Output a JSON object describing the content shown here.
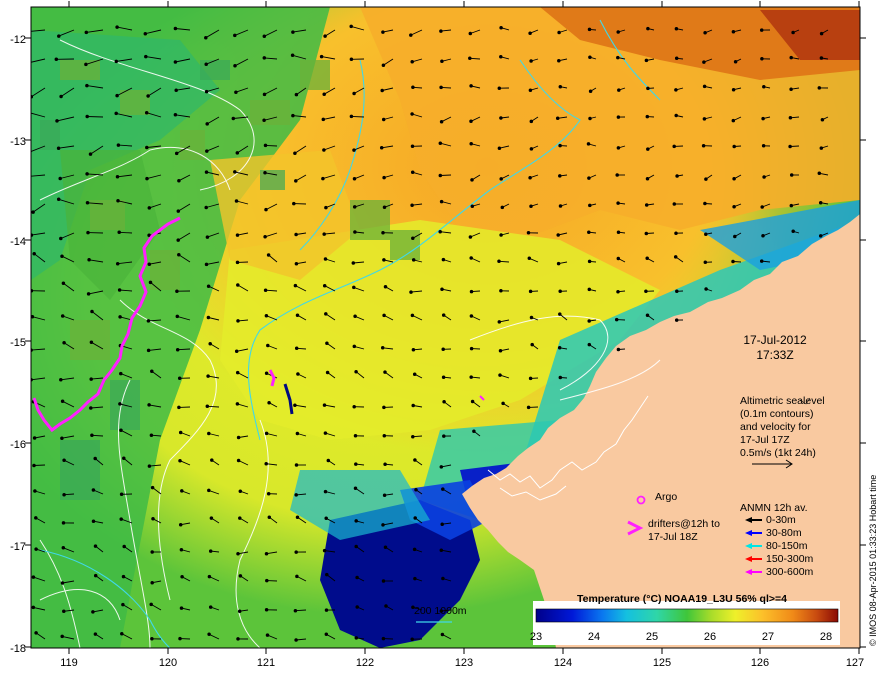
{
  "map": {
    "lon_ticks": [
      "119",
      "120",
      "121",
      "122",
      "123",
      "124",
      "125",
      "126",
      "127"
    ],
    "lat_ticks": [
      "-12",
      "-13",
      "-14",
      "-15",
      "-16",
      "-17",
      "-18"
    ],
    "land_color": "#f9c9a0",
    "contour_color": "#ffffff",
    "isobath_color": "#40d8e8"
  },
  "annotation": {
    "date": "17-Jul-2012",
    "time": "17:33Z",
    "altimetry_lines": [
      "Altimetric sealevel",
      "(0.1m contours)",
      "and velocity for",
      "17-Jul 17Z",
      "0.5m/s (1kt 24h)"
    ]
  },
  "legend": {
    "argo_label": "Argo",
    "drifters_lines": [
      "drifters@12h to",
      "17-Jul 18Z"
    ],
    "anmn_title": "ANMN 12h av.",
    "anmn_items": [
      {
        "label": "0-30m",
        "color": "#000000"
      },
      {
        "label": "30-80m",
        "color": "#0000ff"
      },
      {
        "label": "80-150m",
        "color": "#00e5e5"
      },
      {
        "label": "150-300m",
        "color": "#ff0000"
      },
      {
        "label": "300-600m",
        "color": "#ff00ff"
      }
    ],
    "isobath_label": "200  1000m"
  },
  "colorbar": {
    "title": "Temperature (°C) NOAA19_L3U 56% ql>=4",
    "ticks": [
      "23",
      "24",
      "25",
      "26",
      "27",
      "28"
    ]
  },
  "credit": "© IMOS 08-Apr-2015 01:33:23 Hobart time"
}
